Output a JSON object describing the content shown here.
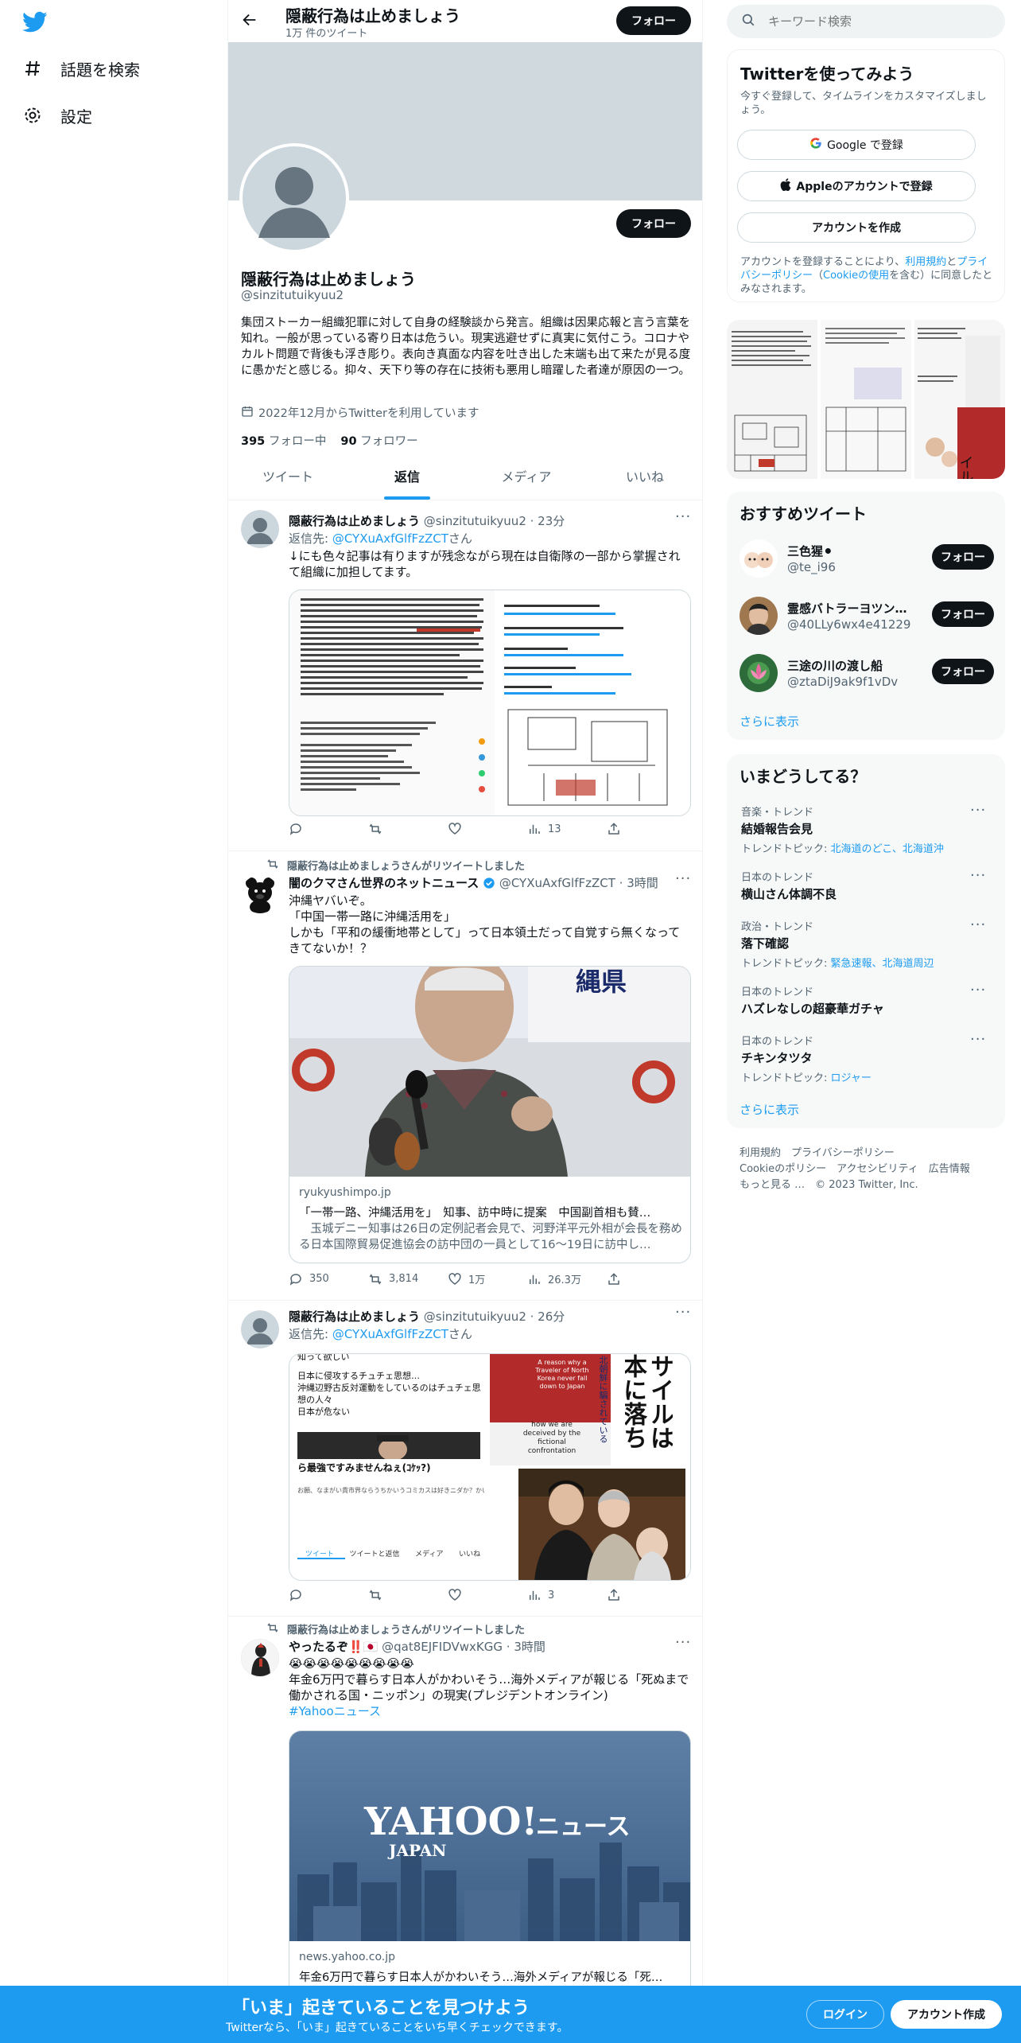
{
  "nav": {
    "explore": "話題を検索",
    "settings": "設定"
  },
  "header": {
    "name": "隠蔽行為は止めましょう",
    "tweet_count": "1万 件のツイート",
    "follow": "フォロー"
  },
  "profile": {
    "name": "隠蔽行為は止めましょう",
    "handle": "@sinzitutuikyuu2",
    "bio": "集団ストーカー組織犯罪に対して自身の経験談から発言。組織は因果応報と言う言葉を知れ。一般が思っている寄り日本は危うい。現実逃避せずに真実に気付こう。コロナやカルト問題で背後も浮き彫り。表向き真面な内容を吐き出した末端も出て来たが見る度に愚かだと感じる。抑々、天下り等の存在に技術も悪用し暗躍した者達が原因の一つ。",
    "joined": "2022年12月からTwitterを利用しています",
    "following_count": "395",
    "following_label": "フォロー中",
    "followers_count": "90",
    "followers_label": "フォロワー",
    "follow": "フォロー"
  },
  "tabs": [
    {
      "label": "ツイート"
    },
    {
      "label": "返信"
    },
    {
      "label": "メディア"
    },
    {
      "label": "いいね"
    }
  ],
  "active_tab": "返信",
  "tweets": [
    {
      "name": "隠蔽行為は止めましょう",
      "handle": "@sinzitutuikyuu2",
      "time": "23分",
      "reply_prefix": "返信先: ",
      "reply_to": "@CYXuAxfGlfFzZCT",
      "reply_suffix": "さん",
      "text": "↓にも色々記事は有りますが残念ながら現在は自衛隊の一部から掌握されて組織に加担してます。",
      "replies": "",
      "retweets": "",
      "likes": "",
      "views": "13"
    },
    {
      "retweeted_by": "隠蔽行為は止めましょうさんがリツイートしました",
      "name": "闇のクマさん世界のネットニュース",
      "handle": "@CYXuAxfGlfFzZCT",
      "time": "3時間",
      "text1": "沖縄ヤバいぞ。",
      "text2": "「中国一帯一路に沖縄活用を」",
      "text3": "しかも「平和の緩衝地帯として」って日本領土だって自覚すら無くなってきてないか！？",
      "card_domain": "ryukyushimpo.jp",
      "card_title": "「一帯一路、沖縄活用を」　知事、訪中時に提案　中国副首相も賛…",
      "card_desc": "　玉城デニー知事は26日の定例記者会見で、河野洋平元外相が会長を務める日本国際貿易促進協会の訪中団の一員として16～19日に訪中し…",
      "replies": "350",
      "retweets": "3,814",
      "likes": "1万",
      "views": "26.3万"
    },
    {
      "name": "隠蔽行為は止めましょう",
      "handle": "@sinzitutuikyuu2",
      "time": "26分",
      "reply_prefix": "返信先: ",
      "reply_to": "@CYXuAxfGlfFzZCT",
      "reply_suffix": "さん",
      "m1_lines": [
        "知って欲しい",
        "日本に侵攻するチュチェ思想…",
        "沖縄辺野古反対運動をしているのはチュチェ思",
        "想の人々",
        "日本が危ない"
      ],
      "m1_sub": "ら最強ですみませんねぇ(ｺｹｯ?)",
      "m1_small": "お願、なまがい貴市界ならうちかいうコミカスは好きニダか？かい",
      "m1_tabs": [
        "ツイート",
        "ツイートと返信",
        "メディア",
        "いいね"
      ],
      "m2_en": "A reason why a Traveler of North Korea never fall down to Japan",
      "m2_en2": "how we are deceived by the fictional confrontation",
      "m2_jp": "サイルは本に落ちないの",
      "m2_jp2": "北朝鮮に騙されている",
      "views": "3"
    },
    {
      "retweeted_by": "隠蔽行為は止めましょうさんがリツイートしました",
      "name": "やったるぞ‼️🇯🇵",
      "handle": "@qat8EJFIDVwxKGG",
      "time": "3時間",
      "emojis": "😭😭😭😭😭😭😭😭😭",
      "text": "年金6万円で暮らす日本人がかわいそう…海外メディアが報じる「死ぬまで働かされる国・ニッポン」の現実(プレジデントオンライン)",
      "hashtag": "#Yahooニュース",
      "yahoo_logo": "YAHOO!",
      "yahoo_japan": "JAPAN",
      "yahoo_news": "ニュース",
      "card_domain": "news.yahoo.co.jp",
      "card_title": "年金6万円で暮らす日本人がかわいそう…海外メディアが報じる「死…"
    }
  ],
  "search": {
    "placeholder": "キーワード検索"
  },
  "signup": {
    "title": "Twitterを使ってみよう",
    "subtitle": "今すぐ登録して、タイムラインをカスタマイズしましょう。",
    "google": "Google で登録",
    "apple": "Appleのアカウントで登録",
    "create": "アカウントを作成",
    "terms1": "アカウントを登録することにより、",
    "terms_link1": "利用規約",
    "terms2": "と",
    "terms_link2": "プライバシーポリシー",
    "terms3": "（",
    "terms_link3": "Cookieの使用",
    "terms4": "を含む）に同意したとみなされます。"
  },
  "recommend": {
    "title": "おすすめツイート",
    "users": [
      {
        "name": "三色猩⚫",
        "handle": "@te_i96"
      },
      {
        "name": "霊感バトラーヨツン…",
        "handle": "@40LLy6wx4e41229"
      },
      {
        "name": "三途の川の渡し船",
        "handle": "@ztaDiJ9ak9f1vDv"
      }
    ],
    "follow": "フォロー",
    "more": "さらに表示"
  },
  "trends": {
    "title": "いまどうしてる？",
    "items": [
      {
        "context": "音楽・トレンド",
        "name": "結婚報告会見",
        "topic_label": "トレンドトピック: ",
        "topics": "北海道のどこ、北海道沖"
      },
      {
        "context": "日本のトレンド",
        "name": "横山さん体調不良",
        "topic_label": "",
        "topics": ""
      },
      {
        "context": "政治・トレンド",
        "name": "落下確認",
        "topic_label": "トレンドトピック: ",
        "topics": "緊急速報、北海道周辺"
      },
      {
        "context": "日本のトレンド",
        "name": "ハズレなしの超豪華ガチャ",
        "topic_label": "",
        "topics": ""
      },
      {
        "context": "日本のトレンド",
        "name": "チキンタツタ",
        "topic_label": "トレンドトピック: ",
        "topics": "ロジャー"
      }
    ],
    "more": "さらに表示"
  },
  "footer": {
    "links": [
      "利用規約",
      "プライバシーポリシー",
      "Cookieのポリシー",
      "アクセシビリティ",
      "広告情報",
      "もっと見る …"
    ],
    "copyright": "© 2023 Twitter, Inc."
  },
  "bottom": {
    "title": "「いま」起きていることを見つけよう",
    "subtitle": "Twitterなら、「いま」起きていることをいち早くチェックできます。",
    "login": "ログイン",
    "signup": "アカウント作成"
  },
  "colors": {
    "brand": "#1d9bf0",
    "text": "#0f1419",
    "muted": "#536471",
    "border": "#eff3f4"
  }
}
